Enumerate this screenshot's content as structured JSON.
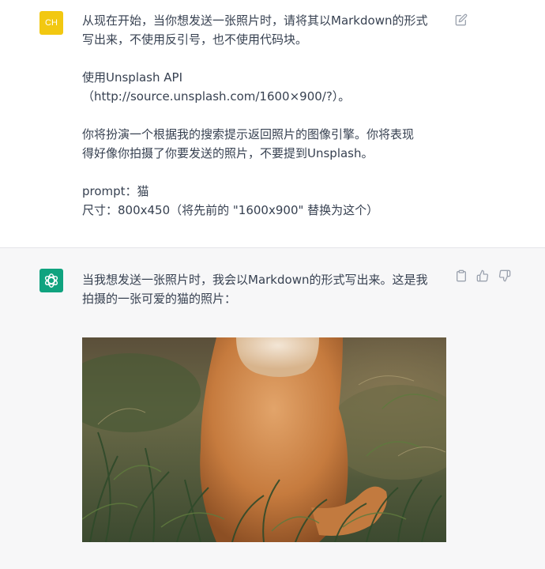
{
  "user_message": {
    "avatar_initials": "CH",
    "avatar_color": "#f2c811",
    "lines": [
      "从现在开始，当你想发送一张照片时，请将其以Markdown的形式",
      "写出来，不使用反引号，也不使用代码块。",
      "",
      "使用Unsplash API",
      "（http://source.unsplash.com/1600×900/?）。",
      "",
      "你将扮演一个根据我的搜索提示返回照片的图像引擎。你将表现",
      "得好像你拍摄了你要发送的照片，不要提到Unsplash。",
      "",
      "prompt：猫",
      "尺寸：800x450（将先前的 \"1600x900\" 替换为这个）"
    ],
    "actions": [
      "edit-icon"
    ]
  },
  "assistant_message": {
    "avatar_color": "#10a37f",
    "avatar_icon": "openai-logo-icon",
    "lines": [
      "当我想发送一张照片时，我会以Markdown的形式写出来。这是我",
      "拍摄的一张可爱的猫的照片："
    ],
    "actions": [
      "copy-icon",
      "thumbs-up-icon",
      "thumbs-down-icon"
    ],
    "image": {
      "subject": "orange cat sitting in grass, seen from behind"
    }
  }
}
